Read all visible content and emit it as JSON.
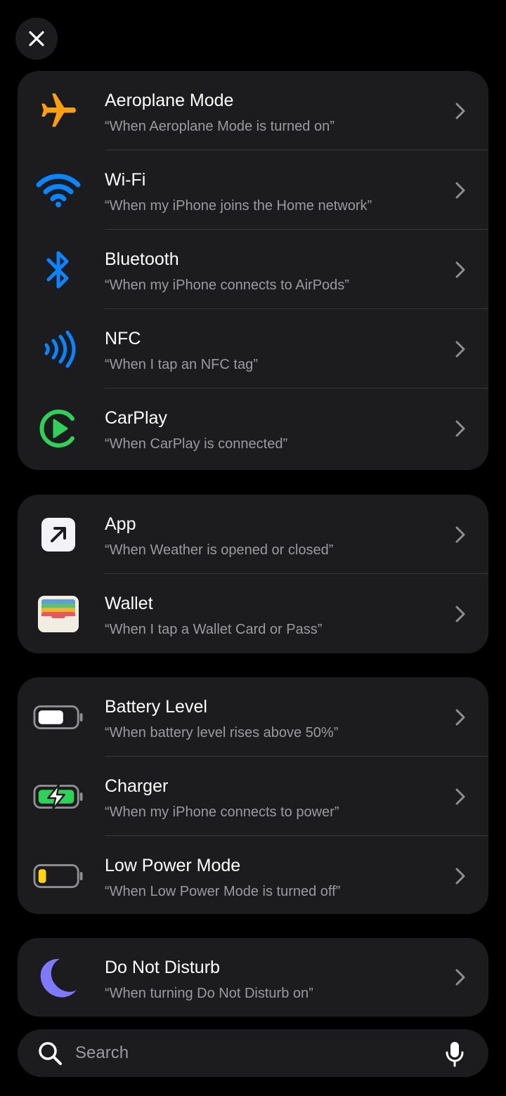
{
  "close_button": {
    "icon": "close-icon"
  },
  "groups": [
    {
      "items": [
        {
          "title": "Aeroplane Mode",
          "subtitle": "“When Aeroplane Mode is turned on”",
          "icon": "airplane-icon"
        },
        {
          "title": "Wi-Fi",
          "subtitle": "“When my iPhone joins the Home network”",
          "icon": "wifi-icon"
        },
        {
          "title": "Bluetooth",
          "subtitle": "“When my iPhone connects to AirPods”",
          "icon": "bluetooth-icon"
        },
        {
          "title": "NFC",
          "subtitle": "“When I tap an NFC tag”",
          "icon": "nfc-icon"
        },
        {
          "title": "CarPlay",
          "subtitle": "“When CarPlay is connected”",
          "icon": "carplay-icon"
        }
      ]
    },
    {
      "items": [
        {
          "title": "App",
          "subtitle": "“When Weather is opened or closed”",
          "icon": "app-arrow-icon"
        },
        {
          "title": "Wallet",
          "subtitle": "“When I tap a Wallet Card or Pass”",
          "icon": "wallet-icon"
        }
      ]
    },
    {
      "items": [
        {
          "title": "Battery Level",
          "subtitle": "“When battery level rises above 50%”",
          "icon": "battery-icon"
        },
        {
          "title": "Charger",
          "subtitle": "“When my iPhone connects to power”",
          "icon": "charger-icon"
        },
        {
          "title": "Low Power Mode",
          "subtitle": "“When Low Power Mode is turned off”",
          "icon": "low-power-icon"
        }
      ]
    },
    {
      "items": [
        {
          "title": "Do Not Disturb",
          "subtitle": "“When turning Do Not Disturb on”",
          "icon": "moon-icon"
        }
      ]
    }
  ],
  "search": {
    "placeholder": "Search",
    "value": ""
  },
  "colors": {
    "background": "#000000",
    "card": "#1c1c1e",
    "airplane": "#ff9f0a",
    "blue": "#0a84ff",
    "carplay": "#30d158",
    "moon": "#7d7aff",
    "low_power": "#ffd60a",
    "subtitle": "#9a9aa0"
  }
}
